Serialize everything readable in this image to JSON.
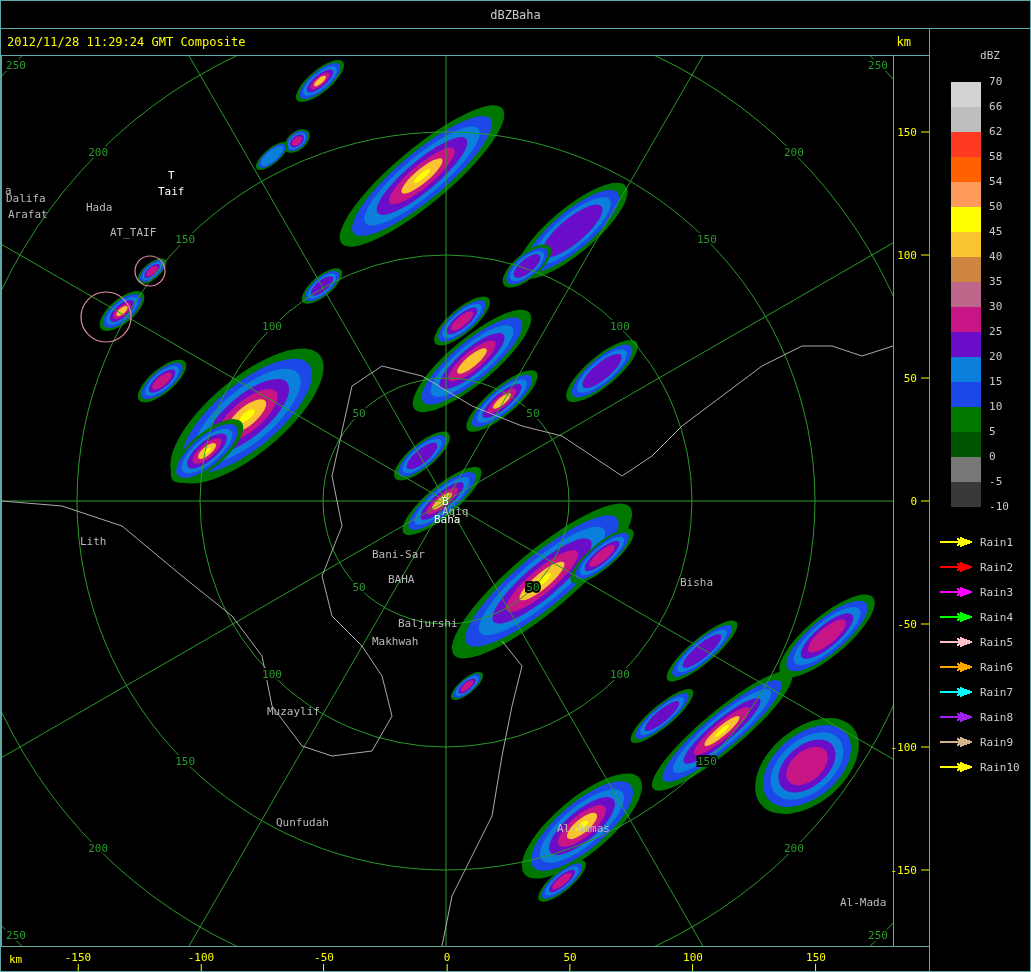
{
  "window": {
    "title": "dBZBaha"
  },
  "header": {
    "timestamp": "2012/11/28 11:29:24 GMT Composite",
    "unit": "km"
  },
  "map": {
    "ring_labels": [
      [
        "50",
        "100",
        "150",
        "200",
        "250"
      ],
      [
        "50",
        "100",
        "150",
        "200",
        "250"
      ],
      [
        "50",
        "100",
        "150",
        "200",
        "250"
      ],
      [
        "50",
        "100",
        "150",
        "200",
        "250"
      ]
    ],
    "places": [
      {
        "name": "a",
        "emphasis": false
      },
      {
        "name": "Dalifa",
        "emphasis": false
      },
      {
        "name": "Arafat",
        "emphasis": false
      },
      {
        "name": "Hada",
        "emphasis": false
      },
      {
        "name": "T",
        "emphasis": true
      },
      {
        "name": "Taif",
        "emphasis": true
      },
      {
        "name": "AT_TAIF",
        "emphasis": false
      },
      {
        "name": "Lith",
        "emphasis": false
      },
      {
        "name": "B",
        "emphasis": true
      },
      {
        "name": "Aqiq",
        "emphasis": false
      },
      {
        "name": "Baha",
        "emphasis": true
      },
      {
        "name": "Bani-Sar",
        "emphasis": false
      },
      {
        "name": "BAHA",
        "emphasis": false
      },
      {
        "name": "Baljurshi",
        "emphasis": false
      },
      {
        "name": "Makhwah",
        "emphasis": false
      },
      {
        "name": "Bisha",
        "emphasis": false
      },
      {
        "name": "Muzaylif",
        "emphasis": false
      },
      {
        "name": "Qunfudah",
        "emphasis": false
      },
      {
        "name": "Al-Namas",
        "emphasis": false
      },
      {
        "name": "Al-Mada",
        "emphasis": false
      }
    ]
  },
  "right_axis": {
    "ticks": [
      "150",
      "100",
      "50",
      "0",
      "-50",
      "-100",
      "-150"
    ]
  },
  "bottom_axis": {
    "unit": "km",
    "ticks": [
      "-150",
      "-100",
      "-50",
      "0",
      "50",
      "100",
      "150"
    ]
  },
  "legend": {
    "title": "dBZ",
    "bands": [
      {
        "color": "#d3d3d3"
      },
      {
        "color": "#bebebe"
      },
      {
        "color": "#ff3a20"
      },
      {
        "color": "#ff6000"
      },
      {
        "color": "#ff9a5a"
      },
      {
        "color": "#ffff00"
      },
      {
        "color": "#fac431"
      },
      {
        "color": "#cd853f"
      },
      {
        "color": "#bc668a"
      },
      {
        "color": "#c71585"
      },
      {
        "color": "#6a0dc8"
      },
      {
        "color": "#0a80dc"
      },
      {
        "color": "#1c48e8"
      },
      {
        "color": "#007800"
      },
      {
        "color": "#005500"
      },
      {
        "color": "#777777"
      },
      {
        "color": "#383838"
      }
    ],
    "scale": [
      "70",
      "66",
      "62",
      "58",
      "54",
      "50",
      "45",
      "40",
      "35",
      "30",
      "25",
      "20",
      "15",
      "10",
      "5",
      "0",
      "-5",
      "-10"
    ],
    "tracks": [
      {
        "label": "Rain1",
        "color": "#ffff00"
      },
      {
        "label": "Rain2",
        "color": "#ff0000"
      },
      {
        "label": "Rain3",
        "color": "#ff00ff"
      },
      {
        "label": "Rain4",
        "color": "#00ff00"
      },
      {
        "label": "Rain5",
        "color": "#ffc0cb"
      },
      {
        "label": "Rain6",
        "color": "#ffa500"
      },
      {
        "label": "Rain7",
        "color": "#00ffff"
      },
      {
        "label": "Rain8",
        "color": "#a020f0"
      },
      {
        "label": "Rain9",
        "color": "#d2b48c"
      },
      {
        "label": "Rain10",
        "color": "#ffff00"
      }
    ]
  }
}
